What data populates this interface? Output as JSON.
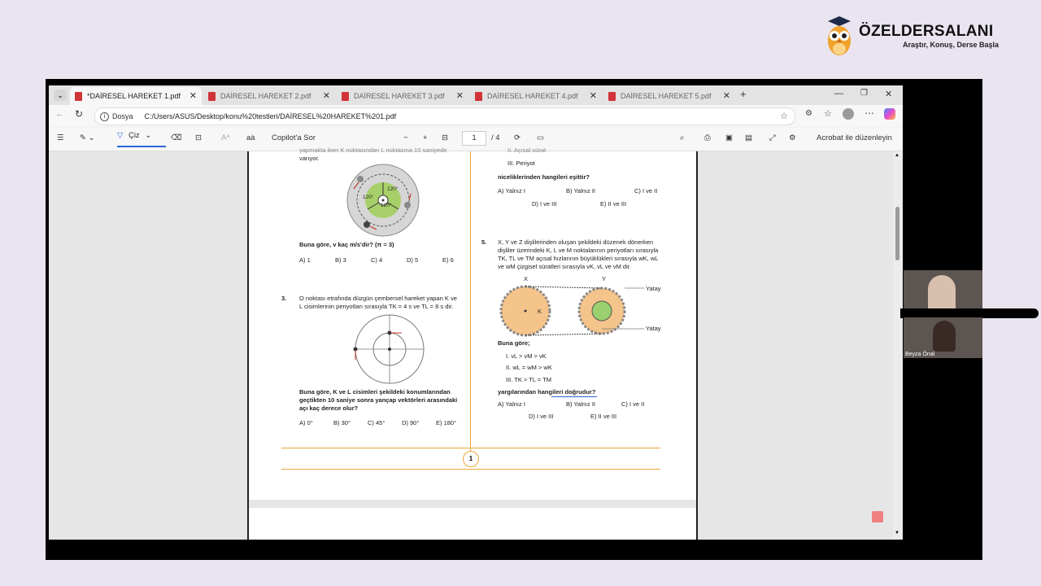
{
  "brand": {
    "name": "ÖZELDERSALANI",
    "tagline": "Araştır, Konuş, Derse Başla"
  },
  "tabs": [
    {
      "label": "*DAİRESEL HAREKET 1.pdf",
      "active": true
    },
    {
      "label": "DAİRESEL HAREKET 2.pdf"
    },
    {
      "label": "DAİRESEL HAREKET 3.pdf"
    },
    {
      "label": "DAİRESEL HAREKET 4.pdf"
    },
    {
      "label": "DAİRESEL HAREKET 5.pdf"
    }
  ],
  "address": {
    "scheme": "Dosya",
    "url": "C:/Users/ASUS/Desktop/konu%20testleri/DAİRESEL%20HAREKET%201.pdf"
  },
  "toolbar": {
    "draw": "Çiz",
    "copilot": "Copilot'a Sor",
    "page": "1",
    "total": "/ 4",
    "acrobat": "Acrobat ile düzenleyin"
  },
  "left": {
    "intro1": "yapmakta iken K noktasından L noktasına 10 saniyede",
    "intro2": "varıyor.",
    "angle": "120°",
    "q2_prompt": "Buna göre, v kaç m/s'dir? (π = 3)",
    "q2_choices": [
      "A) 1",
      "B) 3",
      "C) 4",
      "D) 5",
      "E) 6"
    ],
    "q3_num": "3.",
    "q3_l1": "O noktası etrafında düzgün çembersel hareket yapan K ve",
    "q3_l2": "L cisimlerinin periyotları sırasıyla TK = 4 s ve TL = 8 s dir.",
    "q3_p1": "Buna göre, K ve L cisimleri şekildeki konumlarından",
    "q3_p2": "geçtikten 10 saniye sonra yançap vektörleri arasındaki",
    "q3_p3": "açı kaç derece olur?",
    "q3_choices": [
      "A) 0°",
      "B) 30°",
      "C) 45°",
      "D) 90°",
      "E) 180°"
    ]
  },
  "right": {
    "r1": "II.  Açısal sürat",
    "r2": "III. Periyot",
    "q4_prompt": "niceliklerinden hangileri eşittir?",
    "q4_row1": [
      "A) Yalnız I",
      "B) Yalnız II",
      "C) I ve II"
    ],
    "q4_row2": [
      "D) I ve III",
      "E) II ve III"
    ],
    "q5_num": "5.",
    "q5_l1": "X, Y ve Z dişlilerinden oluşan şekildeki düzenek dönerken",
    "q5_l2": "dişliler üzerindeki K, L ve M noktalarının periyotları sırasıyla",
    "q5_l3": "TK, TL ve TM açısal hızlarının büyüklükleri sırasıyla wK, wL",
    "q5_l4": "ve wM çizgisel süratleri sırasıyla vK, vL ve vM dir.",
    "fig_x": "X",
    "fig_y": "Y",
    "fig_k": "K",
    "yatay": "Yatay",
    "q5_bg": "Buna göre;",
    "s1": "I.   vL > vM > vK",
    "s2": "II.  wL = wM > wK",
    "s3": "III. TK > TL = TM",
    "q5_prompt": "yargılarından hangileri doğrudur?",
    "q5_row1": [
      "A) Yalnız I",
      "B) Yalnız II",
      "C) I ve II"
    ],
    "q5_row2": [
      "D) I ve III",
      "E) II ve III"
    ],
    "page_no": "1"
  },
  "participants": [
    {
      "name": ""
    },
    {
      "name": "Beyza Önal"
    }
  ]
}
